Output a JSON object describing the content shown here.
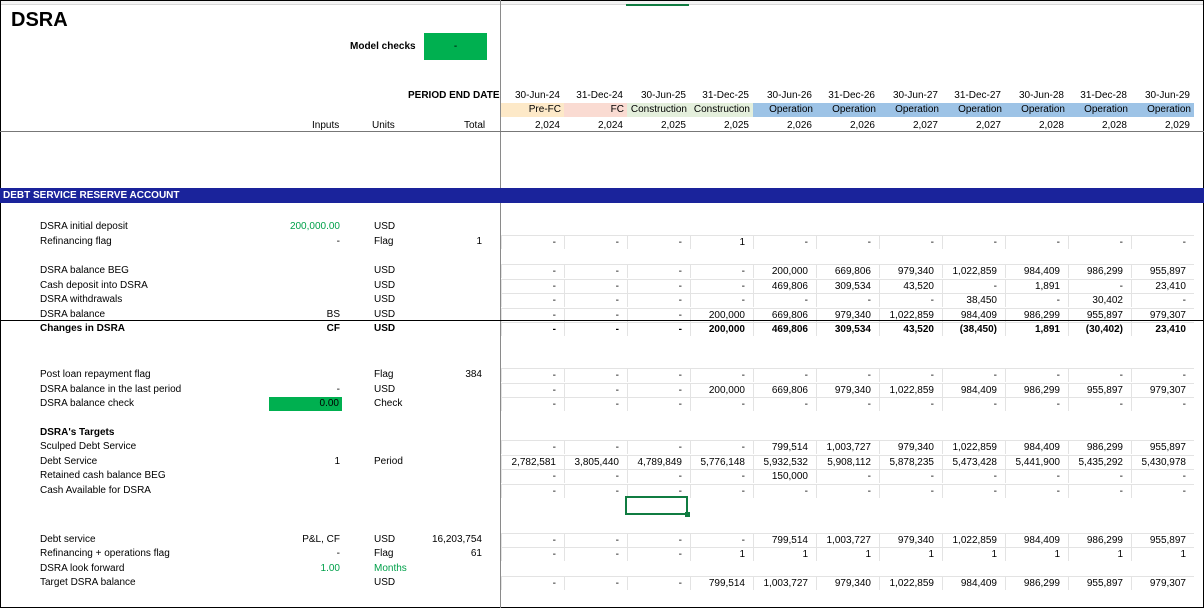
{
  "sheet": {
    "title": "DSRA",
    "model_checks_label": "Model checks",
    "model_checks_value": "-",
    "period_end_label": "PERIOD END DATE",
    "col_headers": {
      "inputs": "Inputs",
      "units": "Units",
      "total": "Total"
    },
    "dates": [
      "30-Jun-24",
      "31-Dec-24",
      "30-Jun-25",
      "31-Dec-25",
      "30-Jun-26",
      "31-Dec-26",
      "30-Jun-27",
      "31-Dec-27",
      "30-Jun-28",
      "31-Dec-28",
      "30-Jun-29"
    ],
    "phases": [
      "Pre-FC",
      "FC",
      "Construction",
      "Construction",
      "Operation",
      "Operation",
      "Operation",
      "Operation",
      "Operation",
      "Operation",
      "Operation"
    ],
    "phase_colors": [
      "#fde9c8",
      "#fadbd2",
      "#e4efdc",
      "#e4efdc",
      "#9dc3e6",
      "#9dc3e6",
      "#9dc3e6",
      "#9dc3e6",
      "#9dc3e6",
      "#9dc3e6",
      "#9dc3e6"
    ],
    "years": [
      "2,024",
      "2,024",
      "2,025",
      "2,025",
      "2,026",
      "2,026",
      "2,027",
      "2,027",
      "2,028",
      "2,028",
      "2,029"
    ],
    "section_title": "DEBT SERVICE RESERVE ACCOUNT",
    "rows": [
      {
        "label": "DSRA initial deposit",
        "input": "200,000.00",
        "input_green": true,
        "unit": "USD",
        "total": "",
        "cells": []
      },
      {
        "label": "Refinancing flag",
        "input": "-",
        "unit": "Flag",
        "total": "1",
        "cells": [
          "-",
          "-",
          "-",
          "1",
          "-",
          "-",
          "-",
          "-",
          "-",
          "-",
          "-"
        ]
      },
      {
        "label": "DSRA balance BEG",
        "input": "",
        "unit": "USD",
        "total": "",
        "cells": [
          "-",
          "-",
          "-",
          "-",
          "200,000",
          "669,806",
          "979,340",
          "1,022,859",
          "984,409",
          "986,299",
          "955,897"
        ]
      },
      {
        "label": "Cash deposit into DSRA",
        "input": "",
        "unit": "USD",
        "total": "",
        "cells": [
          "-",
          "-",
          "-",
          "-",
          "469,806",
          "309,534",
          "43,520",
          "-",
          "1,891",
          "-",
          "23,410"
        ]
      },
      {
        "label": "DSRA withdrawals",
        "input": "",
        "unit": "USD",
        "total": "",
        "cells": [
          "-",
          "-",
          "-",
          "-",
          "-",
          "-",
          "-",
          "38,450",
          "-",
          "30,402",
          "-"
        ]
      },
      {
        "label": "DSRA balance",
        "input": "BS",
        "unit": "USD",
        "total": "",
        "cells": [
          "-",
          "-",
          "-",
          "200,000",
          "669,806",
          "979,340",
          "1,022,859",
          "984,409",
          "986,299",
          "955,897",
          "979,307"
        ]
      },
      {
        "label": "Changes in DSRA",
        "input": "CF",
        "unit": "USD",
        "total": "",
        "bold": true,
        "cells": [
          "-",
          "-",
          "-",
          "200,000",
          "469,806",
          "309,534",
          "43,520",
          "(38,450)",
          "1,891",
          "(30,402)",
          "23,410"
        ]
      },
      {
        "label": "Post loan repayment flag",
        "input": "",
        "unit": "Flag",
        "total": "384",
        "cells": [
          "-",
          "-",
          "-",
          "-",
          "-",
          "-",
          "-",
          "-",
          "-",
          "-",
          "-"
        ]
      },
      {
        "label": "DSRA balance in the last period",
        "input": "-",
        "unit": "USD",
        "total": "",
        "cells": [
          "-",
          "-",
          "-",
          "200,000",
          "669,806",
          "979,340",
          "1,022,859",
          "984,409",
          "986,299",
          "955,897",
          "979,307"
        ]
      },
      {
        "label": "DSRA balance check",
        "input": "0.00",
        "input_box": true,
        "unit": "Check",
        "total": "",
        "cells": [
          "-",
          "-",
          "-",
          "-",
          "-",
          "-",
          "-",
          "-",
          "-",
          "-",
          "-"
        ]
      },
      {
        "label": "DSRA's Targets",
        "input": "",
        "unit": "",
        "total": "",
        "bold": true,
        "cells": []
      },
      {
        "label": "Sculped Debt Service",
        "input": "",
        "unit": "",
        "total": "",
        "cells": [
          "-",
          "-",
          "-",
          "-",
          "799,514",
          "1,003,727",
          "979,340",
          "1,022,859",
          "984,409",
          "986,299",
          "955,897"
        ]
      },
      {
        "label": "Debt Service",
        "input": "1",
        "unit": "Period",
        "total": "",
        "cells": [
          "2,782,581",
          "3,805,440",
          "4,789,849",
          "5,776,148",
          "5,932,532",
          "5,908,112",
          "5,878,235",
          "5,473,428",
          "5,441,900",
          "5,435,292",
          "5,430,978"
        ]
      },
      {
        "label": "Retained cash balance BEG",
        "input": "",
        "unit": "",
        "total": "",
        "cells": [
          "-",
          "-",
          "-",
          "-",
          "150,000",
          "-",
          "-",
          "-",
          "-",
          "-",
          "-"
        ]
      },
      {
        "label": "Cash Available for DSRA",
        "input": "",
        "unit": "",
        "total": "",
        "cells": [
          "-",
          "-",
          "-",
          "-",
          "-",
          "-",
          "-",
          "-",
          "-",
          "-",
          "-"
        ]
      },
      {
        "label": "Debt service",
        "input": "P&L, CF",
        "unit": "USD",
        "total": "16,203,754",
        "cells": [
          "-",
          "-",
          "-",
          "-",
          "799,514",
          "1,003,727",
          "979,340",
          "1,022,859",
          "984,409",
          "986,299",
          "955,897"
        ]
      },
      {
        "label": "Refinancing + operations flag",
        "input": "-",
        "unit": "Flag",
        "total": "61",
        "cells": [
          "-",
          "-",
          "-",
          "1",
          "1",
          "1",
          "1",
          "1",
          "1",
          "1",
          "1"
        ]
      },
      {
        "label": "DSRA look forward",
        "input": "1.00",
        "input_green": true,
        "unit": "Months",
        "unit_green": true,
        "total": "",
        "cells": []
      },
      {
        "label": "Target DSRA balance",
        "input": "",
        "unit": "USD",
        "total": "",
        "cells": [
          "-",
          "-",
          "-",
          "799,514",
          "1,003,727",
          "979,340",
          "1,022,859",
          "984,409",
          "986,299",
          "955,897",
          "979,307"
        ]
      }
    ]
  }
}
